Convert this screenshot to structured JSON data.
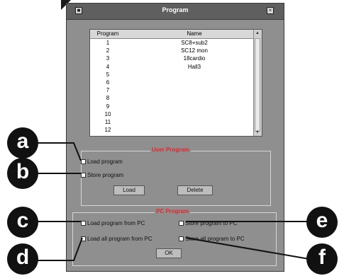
{
  "window": {
    "title": "Program"
  },
  "program_list": {
    "headers": {
      "program": "Program",
      "name": "Name"
    },
    "rows": [
      {
        "program": "1",
        "name": "SC8+sub2"
      },
      {
        "program": "2",
        "name": "SC12 mon"
      },
      {
        "program": "3",
        "name": "18cardio"
      },
      {
        "program": "4",
        "name": "Hall3"
      },
      {
        "program": "5",
        "name": ""
      },
      {
        "program": "6",
        "name": ""
      },
      {
        "program": "7",
        "name": ""
      },
      {
        "program": "8",
        "name": ""
      },
      {
        "program": "9",
        "name": ""
      },
      {
        "program": "10",
        "name": ""
      },
      {
        "program": "11",
        "name": ""
      },
      {
        "program": "12",
        "name": ""
      }
    ]
  },
  "user_program": {
    "label": "User  Program",
    "load_program": "Load program",
    "store_program": "Store program",
    "load_button": "Load",
    "delete_button": "Delete"
  },
  "pc_program": {
    "label": "PC Program",
    "load_from_pc": "Load program from PC",
    "store_to_pc": "Store program to PC",
    "load_all_from_pc": "Load all program from PC",
    "store_all_to_pc": "Store all program to PC",
    "ok_button": "OK"
  },
  "callouts": {
    "a": "a",
    "b": "b",
    "c": "c",
    "d": "d",
    "e": "e",
    "f": "f"
  },
  "colors": {
    "window_bg": "#8f8f8f",
    "group_label": "#e8242a",
    "callout": "#111111"
  }
}
